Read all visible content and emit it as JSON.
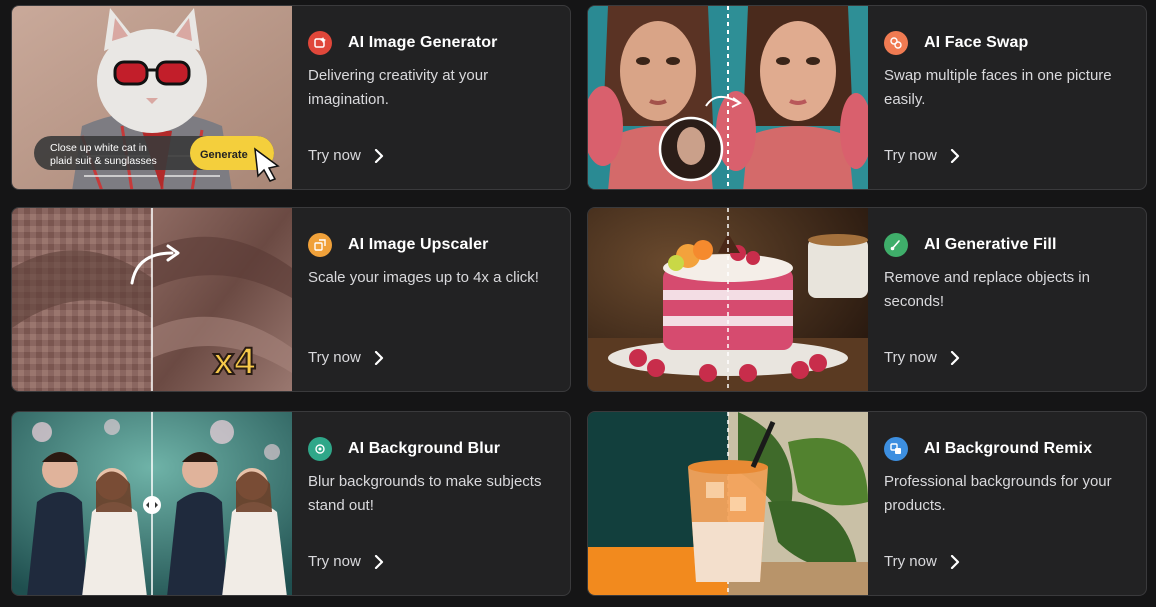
{
  "cards": [
    {
      "title": "AI Image Generator",
      "description": "Delivering creativity at your imagination.",
      "cta": "Try now",
      "icon": "sparkle-image-icon",
      "accent": "#e0473a",
      "thumb_prompt": "Close up white cat in plaid suit & sunglasses",
      "thumb_button": "Generate"
    },
    {
      "title": "AI Face Swap",
      "description": "Swap multiple faces in one picture easily.",
      "cta": "Try now",
      "icon": "face-swap-icon",
      "accent": "#f07b52"
    },
    {
      "title": "AI Image Upscaler",
      "description": "Scale your images up to 4x a click!",
      "cta": "Try now",
      "icon": "upscale-icon",
      "accent": "#f0a13a",
      "thumb_badge": "x4"
    },
    {
      "title": "AI Generative Fill",
      "description": "Remove and replace objects in seconds!",
      "cta": "Try now",
      "icon": "brush-icon",
      "accent": "#3fae6a"
    },
    {
      "title": "AI Background Blur",
      "description": "Blur backgrounds to make subjects stand out!",
      "cta": "Try now",
      "icon": "blur-icon",
      "accent": "#2fa789"
    },
    {
      "title": "AI Background Remix",
      "description": "Professional backgrounds for your products.",
      "cta": "Try now",
      "icon": "remix-icon",
      "accent": "#3d8fe0"
    }
  ]
}
